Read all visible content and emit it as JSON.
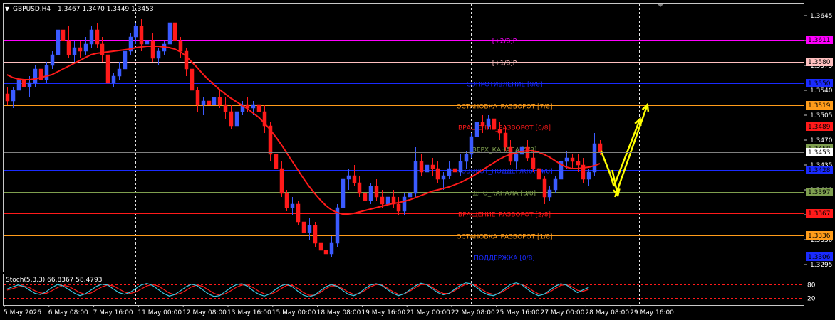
{
  "chart_data": {
    "type": "candlestick",
    "title": {
      "symbol_tf": "GBPUSD,H4",
      "ohlc": "1.3467 1.3470 1.3449 1.3453"
    },
    "colors": {
      "background": "#000000",
      "bull": "#3b5bff",
      "bear": "#ff1a1a",
      "ma": "#ff1a1a",
      "arrow": "#ffff00",
      "grid": "#ffffff",
      "stoch_main": "#36c8e0",
      "stoch_signal": "#ff1a1a"
    },
    "price_axis": {
      "min": 1.3285,
      "max": 1.3662,
      "ticks": [
        "1.3645",
        "1.3610",
        "1.3575",
        "1.3540",
        "1.3505",
        "1.3470",
        "1.3435",
        "1.3400",
        "1.3365",
        "1.3330",
        "1.3295"
      ]
    },
    "murrey_levels": [
      {
        "price": 1.3611,
        "label": "[+2/8]P",
        "price_label": "1.3611",
        "color": "#ff00ff"
      },
      {
        "price": 1.358,
        "label": "[+1/8]P",
        "price_label": "1.3580",
        "color": "#ffc0c0"
      },
      {
        "price": 1.355,
        "label": "СОПРОТИВЛЕНИЕ [8/8]",
        "price_label": "1.3550",
        "color": "#1a2bff"
      },
      {
        "price": 1.3519,
        "label": "ОСТАНОВКА_РАЗВОРОТ [7/8]",
        "price_label": "1.3519",
        "color": "#ff9c1a"
      },
      {
        "price": 1.3489,
        "label": "ВРАЩЕНИЕ_РАЗВОРОТ [6/8]",
        "price_label": "1.3489",
        "color": "#ff1a1a"
      },
      {
        "price": 1.3458,
        "label": "ВЕРХ_КАНАЛА [5/8]",
        "price_label": "1.3458",
        "color": "#7f9f4f"
      },
      {
        "price": 1.3428,
        "label": "ПОВОРОТ_ПОДДЕРЖКА [4/8]",
        "price_label": "1.3428",
        "color": "#1a2bff"
      },
      {
        "price": 1.3397,
        "label": "ДНО_КАНАЛА [3/8]",
        "price_label": "1.3397",
        "color": "#7f9f4f"
      },
      {
        "price": 1.3367,
        "label": "ВРАЩЕНИЕ_РАЗВОРОТ [2/8]",
        "price_label": "1.3367",
        "color": "#ff1a1a"
      },
      {
        "price": 1.3336,
        "label": "ОСТАНОВКА_РАЗВОРОТ [1/8]",
        "price_label": "1.3336",
        "color": "#ff9c1a"
      },
      {
        "price": 1.3306,
        "label": "ПОДДЕРЖКА [0/8]",
        "price_label": "1.3306",
        "color": "#1a2bff"
      }
    ],
    "current_price": {
      "price": 1.3453,
      "label": "1.3453"
    },
    "candles": [
      [
        1.3535,
        1.3545,
        1.352,
        1.3525
      ],
      [
        1.3525,
        1.3545,
        1.3515,
        1.354
      ],
      [
        1.354,
        1.356,
        1.3535,
        1.3555
      ],
      [
        1.3555,
        1.3565,
        1.354,
        1.3545
      ],
      [
        1.3545,
        1.356,
        1.353,
        1.355
      ],
      [
        1.355,
        1.3575,
        1.3545,
        1.357
      ],
      [
        1.357,
        1.358,
        1.355,
        1.3555
      ],
      [
        1.3555,
        1.358,
        1.355,
        1.3575
      ],
      [
        1.3575,
        1.3595,
        1.357,
        1.359
      ],
      [
        1.359,
        1.363,
        1.3585,
        1.3625
      ],
      [
        1.3625,
        1.364,
        1.36,
        1.361
      ],
      [
        1.361,
        1.363,
        1.3585,
        1.359
      ],
      [
        1.359,
        1.361,
        1.358,
        1.36
      ],
      [
        1.36,
        1.361,
        1.3585,
        1.3595
      ],
      [
        1.3595,
        1.3615,
        1.359,
        1.3605
      ],
      [
        1.3605,
        1.363,
        1.36,
        1.3625
      ],
      [
        1.3625,
        1.3635,
        1.36,
        1.3605
      ],
      [
        1.3605,
        1.3615,
        1.358,
        1.359
      ],
      [
        1.359,
        1.3595,
        1.354,
        1.355
      ],
      [
        1.355,
        1.3565,
        1.3545,
        1.356
      ],
      [
        1.356,
        1.358,
        1.3555,
        1.357
      ],
      [
        1.357,
        1.36,
        1.3565,
        1.3595
      ],
      [
        1.3595,
        1.362,
        1.359,
        1.3615
      ],
      [
        1.3615,
        1.3635,
        1.3605,
        1.363
      ],
      [
        1.363,
        1.364,
        1.3595,
        1.3605
      ],
      [
        1.3605,
        1.3615,
        1.359,
        1.361
      ],
      [
        1.361,
        1.362,
        1.358,
        1.3585
      ],
      [
        1.3585,
        1.36,
        1.3575,
        1.3595
      ],
      [
        1.3595,
        1.361,
        1.359,
        1.3605
      ],
      [
        1.3605,
        1.364,
        1.36,
        1.3635
      ],
      [
        1.3635,
        1.3655,
        1.36,
        1.361
      ],
      [
        1.361,
        1.3615,
        1.3585,
        1.3595
      ],
      [
        1.3595,
        1.36,
        1.356,
        1.357
      ],
      [
        1.357,
        1.358,
        1.3535,
        1.354
      ],
      [
        1.354,
        1.3545,
        1.351,
        1.352
      ],
      [
        1.352,
        1.353,
        1.3505,
        1.3525
      ],
      [
        1.3525,
        1.354,
        1.351,
        1.352
      ],
      [
        1.352,
        1.3545,
        1.3515,
        1.353
      ],
      [
        1.353,
        1.354,
        1.3515,
        1.352
      ],
      [
        1.352,
        1.353,
        1.35,
        1.351
      ],
      [
        1.351,
        1.352,
        1.3485,
        1.349
      ],
      [
        1.349,
        1.3515,
        1.3485,
        1.351
      ],
      [
        1.351,
        1.3525,
        1.3505,
        1.352
      ],
      [
        1.352,
        1.353,
        1.351,
        1.3515
      ],
      [
        1.3515,
        1.3525,
        1.3505,
        1.352
      ],
      [
        1.352,
        1.353,
        1.3505,
        1.351
      ],
      [
        1.351,
        1.352,
        1.348,
        1.349
      ],
      [
        1.349,
        1.3495,
        1.344,
        1.345
      ],
      [
        1.345,
        1.346,
        1.342,
        1.343
      ],
      [
        1.343,
        1.344,
        1.339,
        1.3395
      ],
      [
        1.3395,
        1.34,
        1.337,
        1.3375
      ],
      [
        1.3375,
        1.339,
        1.3365,
        1.338
      ],
      [
        1.338,
        1.3385,
        1.335,
        1.3355
      ],
      [
        1.3355,
        1.3365,
        1.333,
        1.334
      ],
      [
        1.334,
        1.336,
        1.333,
        1.335
      ],
      [
        1.335,
        1.3355,
        1.332,
        1.3325
      ],
      [
        1.3325,
        1.333,
        1.331,
        1.3315
      ],
      [
        1.3315,
        1.332,
        1.33,
        1.331
      ],
      [
        1.331,
        1.3335,
        1.3305,
        1.3325
      ],
      [
        1.3325,
        1.338,
        1.332,
        1.3375
      ],
      [
        1.3375,
        1.342,
        1.337,
        1.3415
      ],
      [
        1.3415,
        1.343,
        1.34,
        1.342
      ],
      [
        1.342,
        1.3435,
        1.3405,
        1.341
      ],
      [
        1.341,
        1.342,
        1.339,
        1.3395
      ],
      [
        1.3395,
        1.3405,
        1.338,
        1.3385
      ],
      [
        1.3385,
        1.341,
        1.338,
        1.3405
      ],
      [
        1.3405,
        1.3415,
        1.3385,
        1.339
      ],
      [
        1.339,
        1.34,
        1.3375,
        1.338
      ],
      [
        1.338,
        1.3395,
        1.337,
        1.339
      ],
      [
        1.339,
        1.34,
        1.3375,
        1.338
      ],
      [
        1.338,
        1.339,
        1.3365,
        1.337
      ],
      [
        1.337,
        1.3395,
        1.3365,
        1.339
      ],
      [
        1.339,
        1.34,
        1.338,
        1.3395
      ],
      [
        1.3395,
        1.346,
        1.339,
        1.344
      ],
      [
        1.344,
        1.345,
        1.342,
        1.3425
      ],
      [
        1.3425,
        1.344,
        1.3415,
        1.3435
      ],
      [
        1.3435,
        1.3445,
        1.342,
        1.343
      ],
      [
        1.343,
        1.344,
        1.341,
        1.3415
      ],
      [
        1.3415,
        1.3425,
        1.34,
        1.342
      ],
      [
        1.342,
        1.344,
        1.3415,
        1.343
      ],
      [
        1.343,
        1.3445,
        1.342,
        1.3425
      ],
      [
        1.3425,
        1.345,
        1.342,
        1.344
      ],
      [
        1.344,
        1.3455,
        1.343,
        1.345
      ],
      [
        1.345,
        1.348,
        1.3445,
        1.3475
      ],
      [
        1.3475,
        1.35,
        1.347,
        1.3495
      ],
      [
        1.3495,
        1.3505,
        1.348,
        1.349
      ],
      [
        1.349,
        1.3505,
        1.3485,
        1.35
      ],
      [
        1.35,
        1.351,
        1.348,
        1.3485
      ],
      [
        1.3485,
        1.3495,
        1.347,
        1.348
      ],
      [
        1.348,
        1.349,
        1.3455,
        1.346
      ],
      [
        1.346,
        1.347,
        1.3435,
        1.344
      ],
      [
        1.344,
        1.3455,
        1.343,
        1.345
      ],
      [
        1.345,
        1.3465,
        1.344,
        1.346
      ],
      [
        1.346,
        1.347,
        1.344,
        1.3445
      ],
      [
        1.3445,
        1.3455,
        1.3425,
        1.343
      ],
      [
        1.343,
        1.344,
        1.341,
        1.3415
      ],
      [
        1.3415,
        1.342,
        1.338,
        1.339
      ],
      [
        1.339,
        1.3405,
        1.3385,
        1.34
      ],
      [
        1.34,
        1.342,
        1.3395,
        1.3415
      ],
      [
        1.3415,
        1.3445,
        1.341,
        1.344
      ],
      [
        1.344,
        1.3455,
        1.343,
        1.3445
      ],
      [
        1.3445,
        1.345,
        1.343,
        1.344
      ],
      [
        1.344,
        1.345,
        1.3425,
        1.3435
      ],
      [
        1.3435,
        1.3445,
        1.341,
        1.3415
      ],
      [
        1.3415,
        1.343,
        1.3405,
        1.3425
      ],
      [
        1.3425,
        1.348,
        1.342,
        1.3465
      ],
      [
        1.3465,
        1.347,
        1.3449,
        1.3453
      ]
    ],
    "moving_average": [
      1.3562,
      1.3558,
      1.3556,
      1.3555,
      1.3555,
      1.3556,
      1.3558,
      1.356,
      1.3562,
      1.3566,
      1.357,
      1.3574,
      1.3578,
      1.3582,
      1.3586,
      1.359,
      1.3592,
      1.3593,
      1.3594,
      1.3595,
      1.3596,
      1.3597,
      1.3598,
      1.36,
      1.3601,
      1.3602,
      1.3602,
      1.3602,
      1.3601,
      1.36,
      1.3598,
      1.3594,
      1.3588,
      1.358,
      1.3572,
      1.3563,
      1.3555,
      1.3548,
      1.3541,
      1.3535,
      1.3529,
      1.3524,
      1.3519,
      1.3514,
      1.3508,
      1.3502,
      1.3494,
      1.3485,
      1.3475,
      1.3464,
      1.3452,
      1.344,
      1.3428,
      1.3416,
      1.3405,
      1.3395,
      1.3386,
      1.3378,
      1.3372,
      1.3368,
      1.3366,
      1.3366,
      1.3367,
      1.3369,
      1.3371,
      1.3373,
      1.3375,
      1.3377,
      1.3379,
      1.3381,
      1.3382,
      1.3384,
      1.3386,
      1.3389,
      1.3392,
      1.3395,
      1.3398,
      1.34,
      1.3402,
      1.3404,
      1.3407,
      1.341,
      1.3414,
      1.3418,
      1.3423,
      1.3428,
      1.3433,
      1.3438,
      1.3443,
      1.3447,
      1.345,
      1.3452,
      1.3454,
      1.3455,
      1.3455,
      1.3453,
      1.345,
      1.3446,
      1.3441,
      1.3436,
      1.3432,
      1.343,
      1.343,
      1.3431,
      1.3432,
      1.3434,
      1.3437
    ],
    "forecast_arrows": [
      {
        "from": [
          106.2,
          1.3455
        ],
        "to": [
          107.8,
          1.3423
        ],
        "head": false
      },
      {
        "from": [
          107.8,
          1.3423
        ],
        "to": [
          108.5,
          1.3405
        ],
        "head": false
      },
      {
        "from": [
          108.5,
          1.3405
        ],
        "to": [
          113.2,
          1.35
        ],
        "head": true
      },
      {
        "from": [
          108.7,
          1.339
        ],
        "to": [
          114.5,
          1.352
        ],
        "head": true
      },
      {
        "from": [
          108.2,
          1.3428
        ],
        "to": [
          109.2,
          1.3392
        ],
        "head": true
      }
    ],
    "stochastic": {
      "label": "Stoch(5,3,3) 66.8367 58.4793",
      "levels": [
        80,
        20
      ],
      "axis_labels": [
        "80",
        "20"
      ],
      "main": [
        60,
        70,
        78,
        72,
        55,
        40,
        35,
        48,
        66,
        80,
        74,
        58,
        42,
        30,
        38,
        55,
        72,
        82,
        78,
        60,
        44,
        36,
        45,
        62,
        78,
        85,
        76,
        58,
        40,
        28,
        35,
        52,
        70,
        82,
        75,
        56,
        38,
        26,
        30,
        48,
        66,
        80,
        84,
        72,
        52,
        36,
        28,
        38,
        58,
        75,
        82,
        70,
        50,
        32,
        25,
        33,
        52,
        70,
        80,
        72,
        54,
        36,
        30,
        42,
        62,
        78,
        84,
        76,
        58,
        40,
        30,
        38,
        56,
        74,
        86,
        80,
        62,
        44,
        34,
        40,
        58,
        76,
        88,
        84,
        66,
        46,
        34,
        30,
        42,
        62,
        80,
        88,
        80,
        60,
        42,
        30,
        36,
        54,
        72,
        84,
        78,
        60,
        44,
        56,
        67
      ],
      "signal": [
        55,
        62,
        70,
        74,
        66,
        52,
        42,
        40,
        52,
        66,
        76,
        72,
        58,
        44,
        36,
        42,
        56,
        70,
        78,
        74,
        60,
        46,
        40,
        46,
        60,
        74,
        80,
        74,
        58,
        42,
        34,
        40,
        54,
        70,
        78,
        72,
        56,
        40,
        32,
        38,
        52,
        68,
        78,
        78,
        66,
        50,
        38,
        36,
        46,
        62,
        76,
        76,
        62,
        44,
        32,
        32,
        44,
        62,
        74,
        74,
        62,
        46,
        36,
        40,
        54,
        70,
        80,
        78,
        64,
        48,
        36,
        38,
        50,
        66,
        80,
        80,
        68,
        52,
        40,
        40,
        52,
        68,
        82,
        84,
        74,
        56,
        42,
        36,
        40,
        54,
        70,
        82,
        82,
        70,
        52,
        38,
        36,
        46,
        62,
        76,
        80,
        70,
        54,
        50,
        58
      ]
    },
    "time_axis": {
      "labels": [
        "5 May 2026",
        "6 May 08:00",
        "7 May 16:00",
        "11 May 00:00",
        "12 May 08:00",
        "13 May 16:00",
        "15 May 00:00",
        "18 May 08:00",
        "19 May 16:00",
        "21 May 00:00",
        "22 May 08:00",
        "25 May 16:00",
        "27 May 00:00",
        "28 May 08:00",
        "29 May 16:00"
      ],
      "label_bars": [
        0,
        8,
        16,
        24,
        32,
        40,
        48,
        56,
        64,
        72,
        80,
        88,
        96,
        104,
        112
      ]
    },
    "session_separators_at_bar": [
      23.5,
      53.5,
      83.5,
      113.5
    ]
  }
}
